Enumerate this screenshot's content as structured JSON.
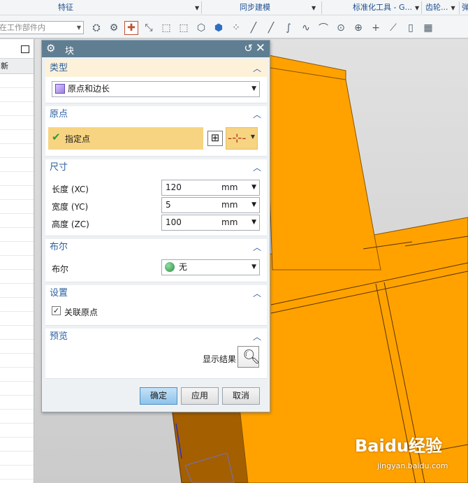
{
  "ribbon": {
    "groups": [
      {
        "label": "特征"
      },
      {
        "label": "同步建模"
      },
      {
        "label": "标准化工具 - G..."
      },
      {
        "label": "齿轮..."
      },
      {
        "label": "弹"
      }
    ],
    "filter_placeholder": "在工作部件内"
  },
  "navigator": {
    "column_header": "新"
  },
  "dialog": {
    "title": "块",
    "type_section": {
      "title": "类型",
      "selected": "原点和边长"
    },
    "origin_section": {
      "title": "原点",
      "specify_label": "指定点"
    },
    "dimension_section": {
      "title": "尺寸",
      "rows": [
        {
          "label": "长度 (XC)",
          "value": "120",
          "unit": "mm"
        },
        {
          "label": "宽度 (YC)",
          "value": "5",
          "unit": "mm"
        },
        {
          "label": "高度 (ZC)",
          "value": "100",
          "unit": "mm"
        }
      ]
    },
    "boolean_section": {
      "title": "布尔",
      "label": "布尔",
      "selected": "无"
    },
    "settings_section": {
      "title": "设置",
      "associative_label": "关联原点",
      "associative_checked": true
    },
    "preview_section": {
      "title": "预览",
      "show_result_label": "显示结果"
    },
    "buttons": {
      "ok": "确定",
      "apply": "应用",
      "cancel": "取消"
    }
  },
  "watermark": {
    "brand": "Baidu经验",
    "url": "jingyan.baidu.com"
  },
  "colors": {
    "title_bar": "#607e92",
    "section_title": "#2a5fa0",
    "highlight": "#f7d481",
    "model_orange": "#ffa200",
    "model_dark": "#a35f00"
  }
}
